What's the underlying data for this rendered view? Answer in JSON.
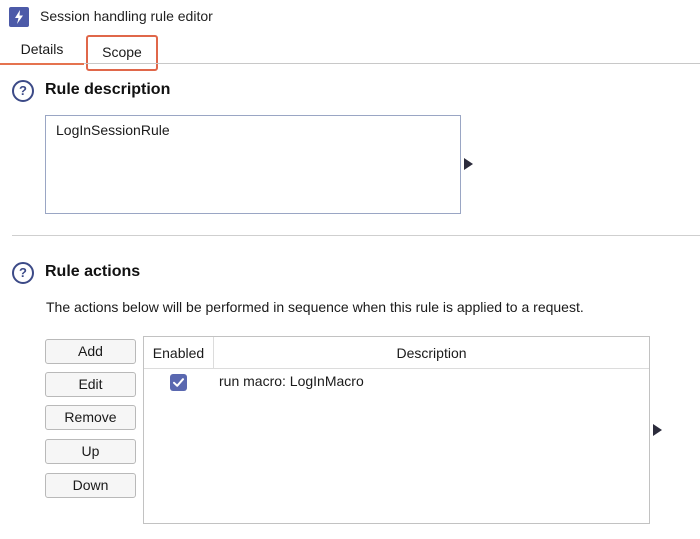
{
  "window": {
    "title": "Session handling rule editor"
  },
  "tabs": [
    {
      "label": "Details",
      "active": true
    },
    {
      "label": "Scope",
      "active": false,
      "highlighted": true
    }
  ],
  "rule_description": {
    "heading": "Rule description",
    "help_icon": "question-circle-icon",
    "value": "LogInSessionRule"
  },
  "rule_actions": {
    "heading": "Rule actions",
    "help_icon": "question-circle-icon",
    "note": "The actions below will be performed in sequence when this rule is applied to a request.",
    "buttons": {
      "add": "Add",
      "edit": "Edit",
      "remove": "Remove",
      "up": "Up",
      "down": "Down"
    },
    "table": {
      "columns": [
        "Enabled",
        "Description"
      ],
      "rows": [
        {
          "enabled": true,
          "description": "run macro: LogInMacro"
        }
      ]
    }
  },
  "colors": {
    "accent": "#e0674a",
    "icon_blue": "#3c4a87",
    "checkbox": "#5a68b0"
  }
}
